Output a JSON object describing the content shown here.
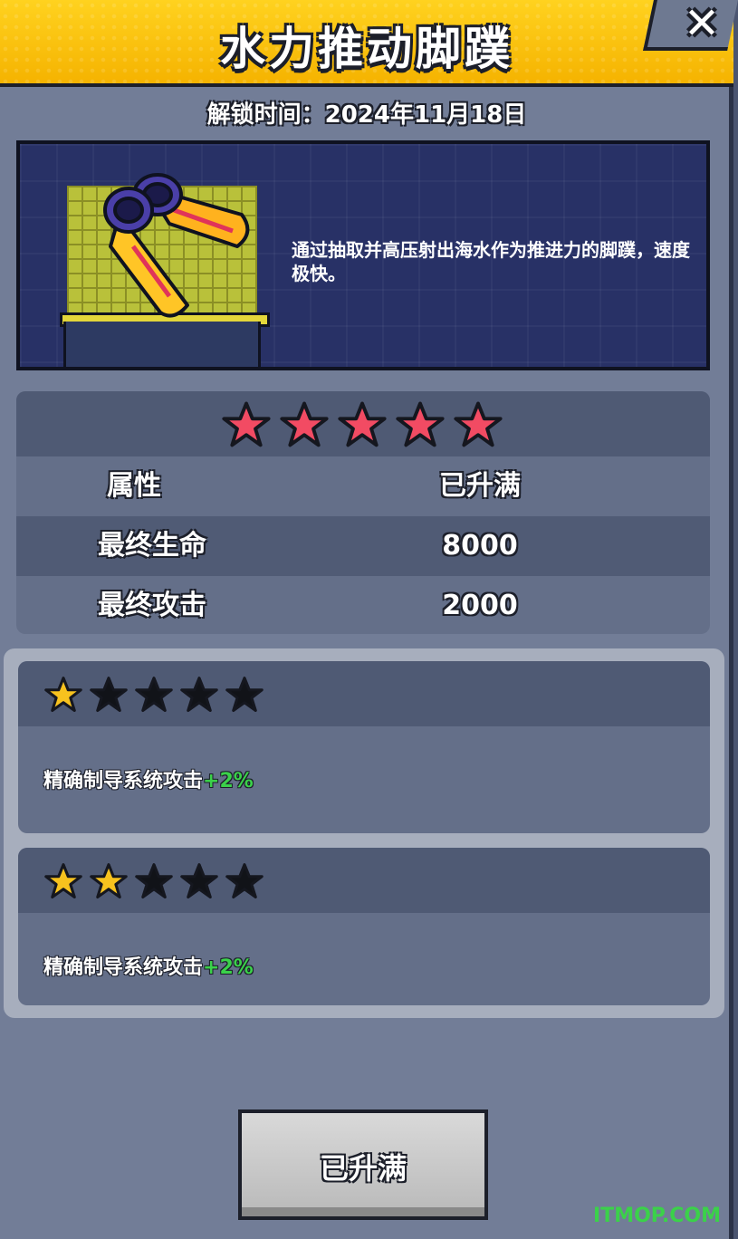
{
  "header": {
    "title": "水力推动脚蹼",
    "close_label": "✕"
  },
  "unlock_time": "解锁时间：2024年11月18日",
  "item": {
    "description": "通过抽取并高压射出海水作为推进力的脚蹼，速度极快。",
    "icon": "swim-fins-icon"
  },
  "stats": {
    "stars": 5,
    "star_color": "#f24b63",
    "header": {
      "label": "属性",
      "status": "已升满"
    },
    "rows": [
      {
        "label": "最终生命",
        "value": "8000"
      },
      {
        "label": "最终攻击",
        "value": "2000"
      }
    ]
  },
  "bonuses": [
    {
      "stars_filled": 1,
      "stars_total": 5,
      "text": "精确制导系统攻击",
      "value": "+2%"
    },
    {
      "stars_filled": 2,
      "stars_total": 5,
      "text": "精确制导系统攻击",
      "value": "+2%"
    }
  ],
  "button": {
    "label": "已升满"
  },
  "watermark": "ITMOP.COM",
  "colors": {
    "header": "#ffc812",
    "bonus_green": "#3bd14a",
    "gold_star": "#f7c21e"
  }
}
